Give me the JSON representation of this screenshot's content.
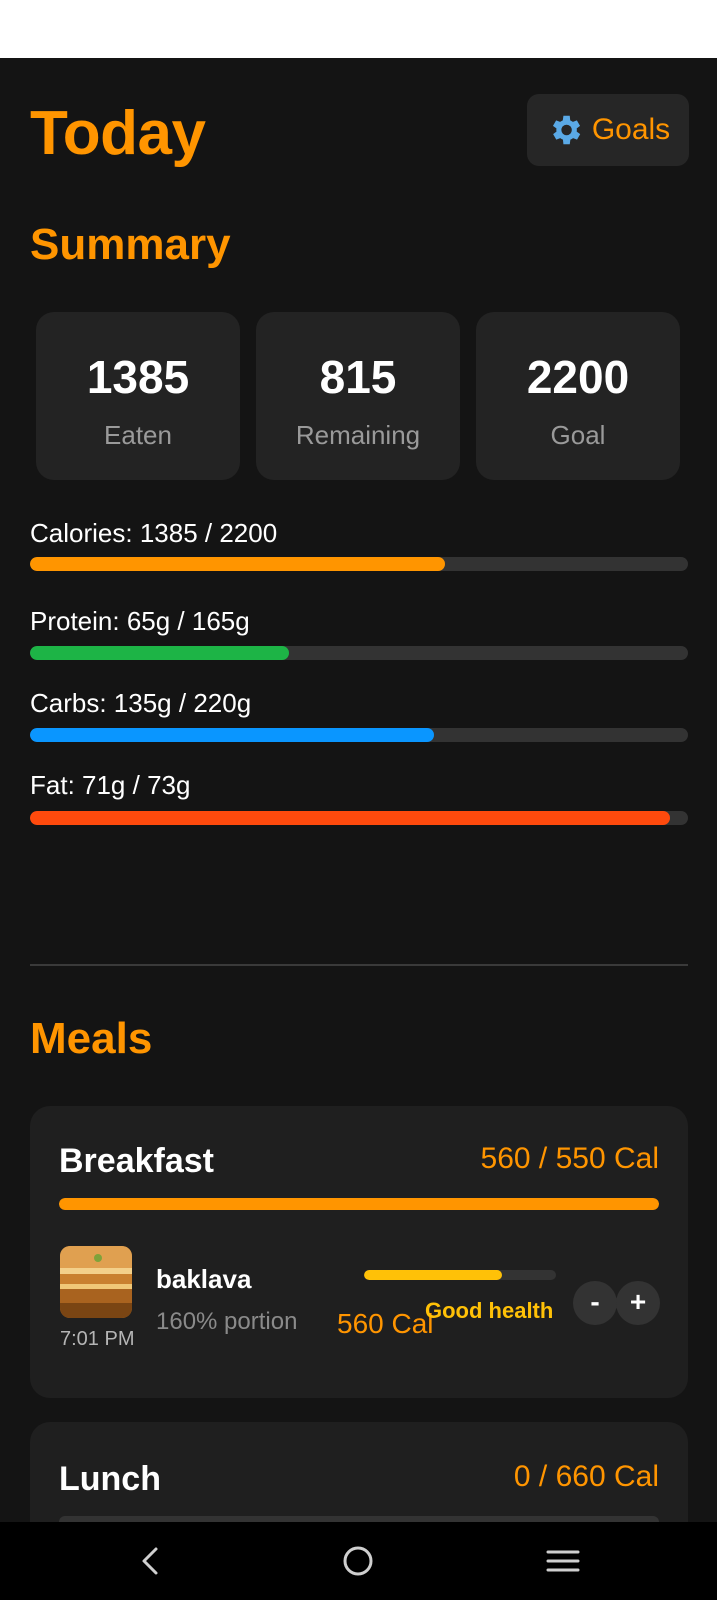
{
  "header": {
    "title": "Today",
    "goals_label": "Goals",
    "goals_icon": "gear-icon"
  },
  "summary": {
    "title": "Summary",
    "cards": [
      {
        "value": "1385",
        "label": "Eaten"
      },
      {
        "value": "815",
        "label": "Remaining"
      },
      {
        "value": "2200",
        "label": "Goal"
      }
    ],
    "macros": [
      {
        "label": "Calories: 1385 / 2200",
        "fraction": 0.63,
        "color": "#ff9500"
      },
      {
        "label": "Protein: 65g / 165g",
        "fraction": 0.394,
        "color": "#1db446"
      },
      {
        "label": "Carbs: 135g / 220g",
        "fraction": 0.614,
        "color": "#0a96ff"
      },
      {
        "label": "Fat: 71g / 73g",
        "fraction": 0.973,
        "color": "#ff4a0d"
      }
    ]
  },
  "meals": {
    "title": "Meals",
    "list": [
      {
        "name": "Breakfast",
        "calories": "560 / 550 Cal",
        "fraction": 1.0,
        "items": [
          {
            "name": "baklava",
            "portion": "160% portion",
            "calories": "560 Cal",
            "time": "7:01 PM",
            "health_label": "Good health",
            "health_fraction": 0.72
          }
        ],
        "minus_label": "-",
        "plus_label": "+"
      },
      {
        "name": "Lunch",
        "calories": "0 / 660 Cal",
        "fraction": 0.0
      }
    ]
  },
  "nav": {
    "back_icon": "back-icon",
    "home_icon": "home-icon",
    "menu_icon": "menu-icon"
  }
}
